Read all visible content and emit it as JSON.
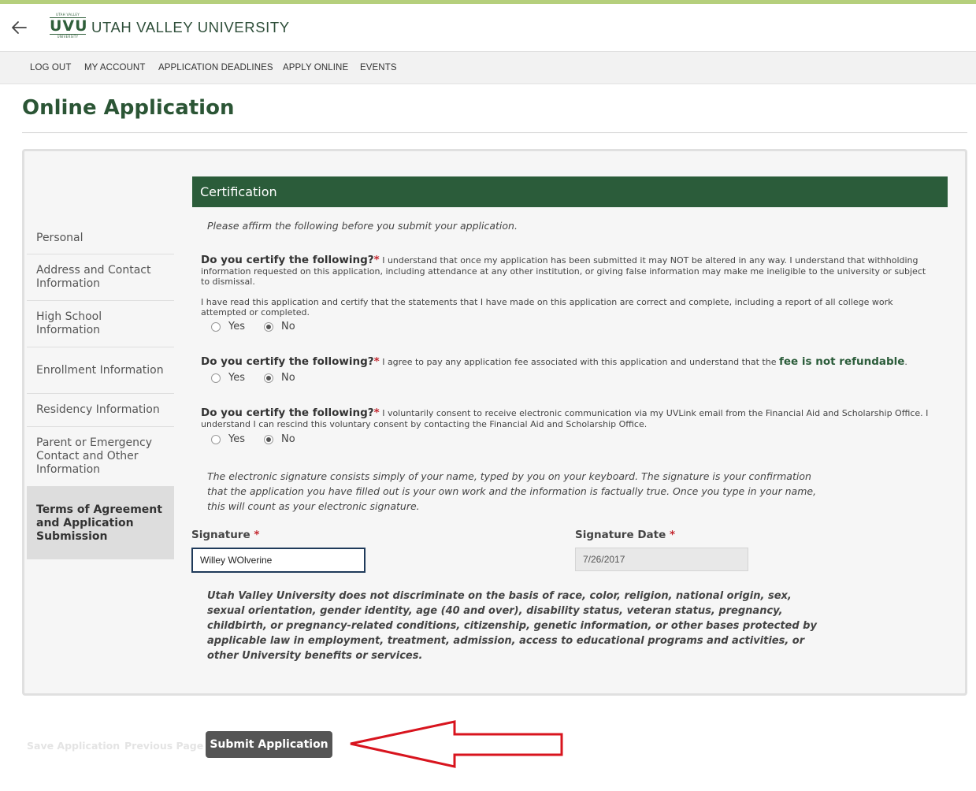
{
  "header": {
    "brand": "UTAH VALLEY UNIVERSITY",
    "logo": {
      "top": "UTAH VALLEY",
      "main": "UVU",
      "bottom": "UNIVERSITY"
    }
  },
  "nav": [
    "LOG OUT",
    "MY ACCOUNT",
    "APPLICATION DEADLINES",
    "APPLY ONLINE",
    "EVENTS"
  ],
  "page_title": "Online Application",
  "sidebar": [
    "Personal",
    "Address and Contact Information",
    "High School Information",
    "Enrollment Information",
    "Residency Information",
    "Parent or Emergency Contact and Other Information",
    "Terms of Agreement and Application Submission"
  ],
  "certification": {
    "heading": "Certification",
    "intro": "Please affirm the following before you submit your application.",
    "required_mark": "*",
    "yes_label": "Yes",
    "no_label": "No",
    "q1": {
      "label": "Do you certify the following?",
      "text": "I understand that once my application has been submitted it may NOT be altered in any way. I understand that withholding information requested on this application, including attendance at any other institution, or giving false information may make me ineligible to the university or subject to dismissal.",
      "text2": "I have read this application and certify that the statements that I have made on this application are correct and complete, including a report of all college work attempted or completed.",
      "selected": "No"
    },
    "q2": {
      "label": "Do you certify the following?",
      "text": "I agree to pay any application fee associated with this application and understand that the",
      "fee": "fee is not refundable",
      "end": ".",
      "selected": "No"
    },
    "q3": {
      "label": "Do you certify the following?",
      "text": "I voluntarily consent to receive electronic communication via my UVLink email from the Financial Aid and Scholarship Office. I understand I can rescind this voluntary consent by contacting the Financial Aid and Scholarship Office.",
      "selected": "No"
    },
    "signature_note": "The electronic signature consists simply of your name, typed by you on your keyboard. The signature is your confirmation that the application you have filled out is your own work and the information is factually true. Once you type in your name, this will count as your electronic signature.",
    "signature_label": "Signature",
    "signature_value": "Willey WOlverine",
    "signature_date_label": "Signature Date",
    "signature_date_value": "7/26/2017",
    "nondiscrimination": "Utah Valley University does not discriminate on the basis of race, color, religion, national origin, sex, sexual orientation, gender identity, age (40 and over), disability status, veteran status, pregnancy, childbirth, or pregnancy-related conditions, citizenship, genetic information, or other bases protected by applicable law in employment, treatment, admission, access to educational programs and activities, or other University benefits or services."
  },
  "footer": {
    "save": "Save Application",
    "previous": "Previous Page",
    "submit": "Submit Application"
  },
  "colors": {
    "accent_green": "#2b5c3a",
    "required_red": "#c3262e",
    "annotation_red": "#d8141e",
    "top_stripe": "#b5cf7c"
  }
}
